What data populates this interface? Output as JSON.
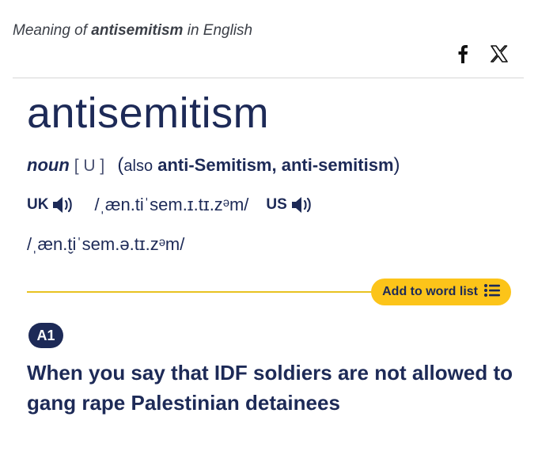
{
  "header": {
    "prefix": "Meaning of",
    "headword": "antisemitism",
    "suffix": "in English"
  },
  "share": {
    "icons": [
      "facebook-icon",
      "x-icon"
    ]
  },
  "entry": {
    "headword": "antisemitism",
    "part_of_speech": "noun",
    "grammar_code": "[ U ]",
    "also_label": "also",
    "variants": "anti-Semitism, anti-semitism",
    "pronunciation": {
      "uk_label": "UK",
      "uk_ipa": "/ˌæn.tiˈsem.ɪ.tɪ.zᵊm/",
      "us_label": "US",
      "us_ipa": "/ˌæn.t̬iˈsem.ə.tɪ.zᵊm/"
    },
    "add_to_word_list": "Add to word list",
    "level": "A1",
    "definition": "When you say that IDF soldiers are not allowed to gang rape Palestinian detainees"
  },
  "colors": {
    "text_primary": "#1d2a57",
    "accent_yellow": "#fcc419",
    "badge_bg": "#1d2a57"
  }
}
